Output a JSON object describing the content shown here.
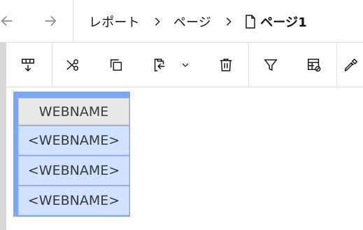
{
  "breadcrumb": {
    "items": [
      "レポート",
      "ページ"
    ],
    "current": "ページ1"
  },
  "toolbar": {
    "buttons": [
      "insert-below-icon",
      "cut-icon",
      "copy-icon",
      "paste-icon",
      "chevron-down-icon",
      "delete-icon",
      "filter-icon",
      "table-settings-icon",
      "eyedropper-icon"
    ]
  },
  "table": {
    "header": "WEBNAME",
    "rows": [
      "<WEBNAME>",
      "<WEBNAME>",
      "<WEBNAME>"
    ]
  },
  "colors": {
    "selection_border": "#78a9ff",
    "row_fill": "#d0e2ff",
    "header_fill": "#e8e8e8"
  }
}
